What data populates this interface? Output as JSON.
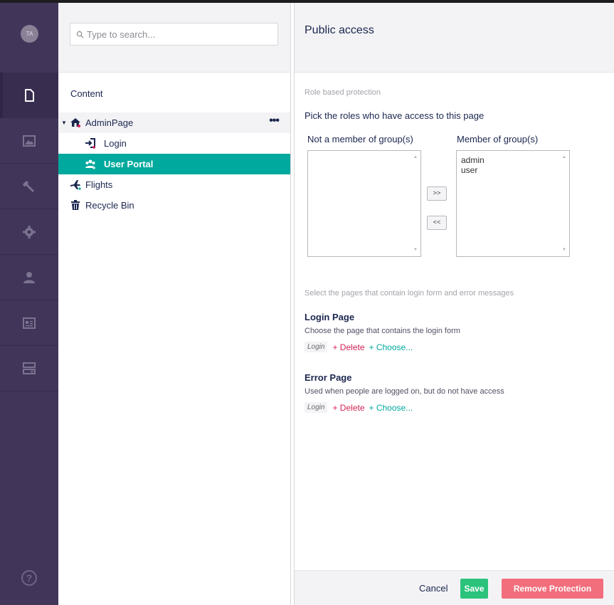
{
  "user": {
    "initials": "TA"
  },
  "rail": {
    "sections": [
      {
        "name": "content",
        "icon": "document-icon",
        "active": true
      },
      {
        "name": "media",
        "icon": "image-icon"
      },
      {
        "name": "settings",
        "icon": "wrench-icon"
      },
      {
        "name": "developer",
        "icon": "gear-icon"
      },
      {
        "name": "users",
        "icon": "user-icon"
      },
      {
        "name": "members",
        "icon": "id-card-icon"
      },
      {
        "name": "forms",
        "icon": "form-icon"
      }
    ],
    "help_label": "?"
  },
  "tree": {
    "search_placeholder": "Type to search...",
    "heading": "Content",
    "nodes": [
      {
        "label": "AdminPage",
        "icon": "home-icon",
        "more": "•••"
      },
      {
        "label": "Login",
        "icon": "login-icon"
      },
      {
        "label": "User Portal",
        "icon": "group-icon"
      },
      {
        "label": "Flights",
        "icon": "plane-icon"
      },
      {
        "label": "Recycle Bin",
        "icon": "trash-icon"
      }
    ]
  },
  "dialog": {
    "title": "Public access",
    "role_section_label": "Role based protection",
    "role_instructions": "Pick the roles who have access to this page",
    "not_member_label": "Not a member of group(s)",
    "member_label": "Member of group(s)",
    "not_member_options": [],
    "member_options": [
      "admin",
      "user"
    ],
    "add_button": ">>",
    "remove_button": "<<",
    "pages_section_label": "Select the pages that contain login form and error messages",
    "login_page": {
      "title": "Login Page",
      "description": "Choose the page that contains the login form",
      "selected": "Login",
      "delete_label": "+ Delete",
      "choose_label": "+ Choose..."
    },
    "error_page": {
      "title": "Error Page",
      "description": "Used when people are logged on, but do not have access",
      "selected": "Login",
      "delete_label": "+ Delete",
      "choose_label": "+ Choose..."
    },
    "footer": {
      "cancel_label": "Cancel",
      "save_label": "Save",
      "remove_label": "Remove Protection"
    }
  },
  "colors": {
    "rail_bg": "#413659",
    "accent_teal": "#00a99d",
    "save_green": "#2bc37c",
    "remove_red": "#f26e7c",
    "delete_red": "#d42054",
    "text_dark": "#1b264f"
  }
}
